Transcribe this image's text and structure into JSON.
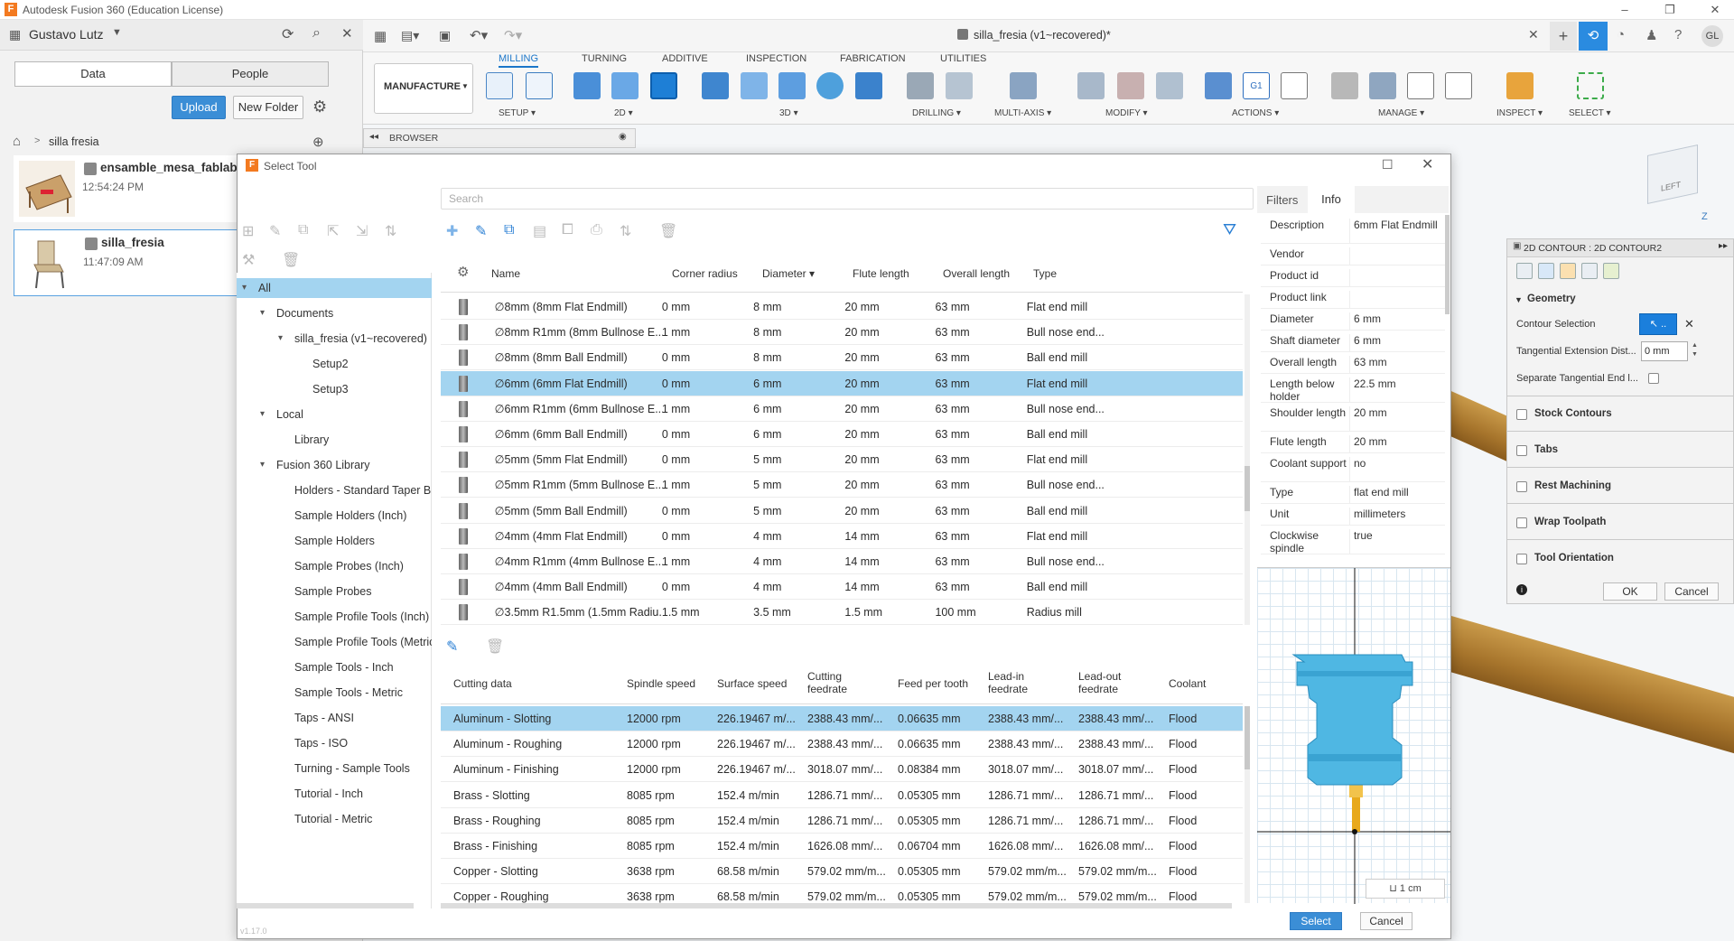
{
  "window": {
    "title": "Autodesk Fusion 360 (Education License)",
    "logo": "F"
  },
  "user": {
    "name": "Gustavo Lutz"
  },
  "left_panel": {
    "tabs": [
      "Data",
      "People"
    ],
    "upload_label": "Upload",
    "new_folder_label": "New Folder",
    "breadcrumb": "silla fresia",
    "items": [
      {
        "name": "ensamble_mesa_fablab",
        "time": "12:54:24 PM"
      },
      {
        "name": "silla_fresia",
        "time": "11:47:09 AM"
      }
    ]
  },
  "document": {
    "tab_title": "silla_fresia (v1~recovered)*"
  },
  "ribbon": {
    "workspace": "MANUFACTURE",
    "tabs": [
      "MILLING",
      "TURNING",
      "ADDITIVE",
      "INSPECTION",
      "FABRICATION",
      "UTILITIES"
    ],
    "groups": [
      "SETUP",
      "2D",
      "3D",
      "DRILLING",
      "MULTI-AXIS",
      "MODIFY",
      "ACTIONS",
      "MANAGE",
      "INSPECT",
      "SELECT"
    ]
  },
  "browser": {
    "label": "BROWSER"
  },
  "dialog": {
    "title": "Select Tool",
    "search_placeholder": "Search",
    "right_tabs": [
      "Filters",
      "Info"
    ],
    "select_label": "Select",
    "cancel_label": "Cancel",
    "version": "v1.17.0"
  },
  "tree": [
    {
      "label": "All",
      "level": 0,
      "selected": true,
      "arrow": "▾"
    },
    {
      "label": "Documents",
      "level": 1,
      "arrow": "▾"
    },
    {
      "label": "silla_fresia (v1~recovered)",
      "level": 2,
      "arrow": "▾"
    },
    {
      "label": "Setup2",
      "level": 3
    },
    {
      "label": "Setup3",
      "level": 3
    },
    {
      "label": "Local",
      "level": 1,
      "arrow": "▾"
    },
    {
      "label": "Library",
      "level": 2
    },
    {
      "label": "Fusion 360 Library",
      "level": 1,
      "arrow": "▾"
    },
    {
      "label": "Holders - Standard Taper Blanks",
      "level": 2
    },
    {
      "label": "Sample Holders (Inch)",
      "level": 2
    },
    {
      "label": "Sample Holders",
      "level": 2
    },
    {
      "label": "Sample Probes (Inch)",
      "level": 2
    },
    {
      "label": "Sample Probes",
      "level": 2
    },
    {
      "label": "Sample Profile Tools (Inch)",
      "level": 2
    },
    {
      "label": "Sample Profile Tools (Metric)",
      "level": 2
    },
    {
      "label": "Sample Tools - Inch",
      "level": 2
    },
    {
      "label": "Sample Tools - Metric",
      "level": 2
    },
    {
      "label": "Taps - ANSI",
      "level": 2
    },
    {
      "label": "Taps - ISO",
      "level": 2
    },
    {
      "label": "Turning - Sample Tools",
      "level": 2
    },
    {
      "label": "Tutorial - Inch",
      "level": 2
    },
    {
      "label": "Tutorial - Metric",
      "level": 2
    }
  ],
  "tools": {
    "columns": [
      "Name",
      "Corner radius",
      "Diameter",
      "Flute length",
      "Overall length",
      "Type"
    ],
    "sort_indicator": "▾",
    "rows": [
      {
        "name": "∅8mm (8mm Flat Endmill)",
        "corner": "0 mm",
        "dia": "8 mm",
        "flute": "20 mm",
        "overall": "63 mm",
        "type": "Flat end mill"
      },
      {
        "name": "∅8mm R1mm (8mm Bullnose E...",
        "corner": "1 mm",
        "dia": "8 mm",
        "flute": "20 mm",
        "overall": "63 mm",
        "type": "Bull nose end..."
      },
      {
        "name": "∅8mm (8mm Ball Endmill)",
        "corner": "0 mm",
        "dia": "8 mm",
        "flute": "20 mm",
        "overall": "63 mm",
        "type": "Ball end mill"
      },
      {
        "name": "∅6mm (6mm Flat Endmill)",
        "corner": "0 mm",
        "dia": "6 mm",
        "flute": "20 mm",
        "overall": "63 mm",
        "type": "Flat end mill",
        "selected": true
      },
      {
        "name": "∅6mm R1mm (6mm Bullnose E...",
        "corner": "1 mm",
        "dia": "6 mm",
        "flute": "20 mm",
        "overall": "63 mm",
        "type": "Bull nose end..."
      },
      {
        "name": "∅6mm (6mm Ball Endmill)",
        "corner": "0 mm",
        "dia": "6 mm",
        "flute": "20 mm",
        "overall": "63 mm",
        "type": "Ball end mill"
      },
      {
        "name": "∅5mm (5mm Flat Endmill)",
        "corner": "0 mm",
        "dia": "5 mm",
        "flute": "20 mm",
        "overall": "63 mm",
        "type": "Flat end mill"
      },
      {
        "name": "∅5mm R1mm (5mm Bullnose E...",
        "corner": "1 mm",
        "dia": "5 mm",
        "flute": "20 mm",
        "overall": "63 mm",
        "type": "Bull nose end..."
      },
      {
        "name": "∅5mm (5mm Ball Endmill)",
        "corner": "0 mm",
        "dia": "5 mm",
        "flute": "20 mm",
        "overall": "63 mm",
        "type": "Ball end mill"
      },
      {
        "name": "∅4mm (4mm Flat Endmill)",
        "corner": "0 mm",
        "dia": "4 mm",
        "flute": "14 mm",
        "overall": "63 mm",
        "type": "Flat end mill"
      },
      {
        "name": "∅4mm R1mm (4mm Bullnose E...",
        "corner": "1 mm",
        "dia": "4 mm",
        "flute": "14 mm",
        "overall": "63 mm",
        "type": "Bull nose end..."
      },
      {
        "name": "∅4mm (4mm Ball Endmill)",
        "corner": "0 mm",
        "dia": "4 mm",
        "flute": "14 mm",
        "overall": "63 mm",
        "type": "Ball end mill"
      },
      {
        "name": "∅3.5mm R1.5mm (1.5mm Radiu...",
        "corner": "1.5 mm",
        "dia": "3.5 mm",
        "flute": "1.5 mm",
        "overall": "100 mm",
        "type": "Radius mill"
      }
    ]
  },
  "cutting": {
    "columns": [
      "Cutting data",
      "Spindle speed",
      "Surface speed",
      "Cutting feedrate",
      "Feed per tooth",
      "Lead-in feedrate",
      "Lead-out feedrate",
      "Coolant"
    ],
    "rows": [
      {
        "name": "Aluminum - Slotting",
        "spindle": "12000 rpm",
        "surface": "226.19467 m/...",
        "feed": "2388.43 mm/...",
        "fpt": "0.06635 mm",
        "leadin": "2388.43 mm/...",
        "leadout": "2388.43 mm/...",
        "coolant": "Flood",
        "selected": true
      },
      {
        "name": "Aluminum - Roughing",
        "spindle": "12000 rpm",
        "surface": "226.19467 m/...",
        "feed": "2388.43 mm/...",
        "fpt": "0.06635 mm",
        "leadin": "2388.43 mm/...",
        "leadout": "2388.43 mm/...",
        "coolant": "Flood"
      },
      {
        "name": "Aluminum - Finishing",
        "spindle": "12000 rpm",
        "surface": "226.19467 m/...",
        "feed": "3018.07 mm/...",
        "fpt": "0.08384 mm",
        "leadin": "3018.07 mm/...",
        "leadout": "3018.07 mm/...",
        "coolant": "Flood"
      },
      {
        "name": "Brass - Slotting",
        "spindle": "8085 rpm",
        "surface": "152.4 m/min",
        "feed": "1286.71 mm/...",
        "fpt": "0.05305 mm",
        "leadin": "1286.71 mm/...",
        "leadout": "1286.71 mm/...",
        "coolant": "Flood"
      },
      {
        "name": "Brass - Roughing",
        "spindle": "8085 rpm",
        "surface": "152.4 m/min",
        "feed": "1286.71 mm/...",
        "fpt": "0.05305 mm",
        "leadin": "1286.71 mm/...",
        "leadout": "1286.71 mm/...",
        "coolant": "Flood"
      },
      {
        "name": "Brass - Finishing",
        "spindle": "8085 rpm",
        "surface": "152.4 m/min",
        "feed": "1626.08 mm/...",
        "fpt": "0.06704 mm",
        "leadin": "1626.08 mm/...",
        "leadout": "1626.08 mm/...",
        "coolant": "Flood"
      },
      {
        "name": "Copper - Slotting",
        "spindle": "3638 rpm",
        "surface": "68.58 m/min",
        "feed": "579.02 mm/m...",
        "fpt": "0.05305 mm",
        "leadin": "579.02 mm/m...",
        "leadout": "579.02 mm/m...",
        "coolant": "Flood"
      },
      {
        "name": "Copper - Roughing",
        "spindle": "3638 rpm",
        "surface": "68.58 m/min",
        "feed": "579.02 mm/m...",
        "fpt": "0.05305 mm",
        "leadin": "579.02 mm/m...",
        "leadout": "579.02 mm/m...",
        "coolant": "Flood"
      }
    ]
  },
  "info": [
    {
      "label": "Description",
      "value": "6mm Flat Endmill"
    },
    {
      "label": "Vendor",
      "value": ""
    },
    {
      "label": "Product id",
      "value": ""
    },
    {
      "label": "Product link",
      "value": ""
    },
    {
      "label": "Diameter",
      "value": "6 mm"
    },
    {
      "label": "Shaft diameter",
      "value": "6 mm"
    },
    {
      "label": "Overall length",
      "value": "63 mm"
    },
    {
      "label": "Length below holder",
      "value": "22.5 mm"
    },
    {
      "label": "Shoulder length",
      "value": "20 mm"
    },
    {
      "label": "Flute length",
      "value": "20 mm"
    },
    {
      "label": "Coolant support",
      "value": "no"
    },
    {
      "label": "Type",
      "value": "flat end mill"
    },
    {
      "label": "Unit",
      "value": "millimeters"
    },
    {
      "label": "Clockwise spindle",
      "value": "true"
    }
  ],
  "preview": {
    "scale_label": "1 cm",
    "holder_color": "#4fb7e3",
    "tool_color": "#e8a91c"
  },
  "contour": {
    "title": "2D CONTOUR : 2D CONTOUR2",
    "geometry_label": "Geometry",
    "contour_selection_label": "Contour Selection",
    "tangential_ext_label": "Tangential Extension Dist...",
    "tangential_ext_value": "0 mm",
    "separate_tangential_label": "Separate Tangential End l...",
    "sections": [
      "Stock Contours",
      "Tabs",
      "Rest Machining",
      "Wrap Toolpath",
      "Tool Orientation"
    ],
    "ok_label": "OK",
    "cancel_label": "Cancel"
  },
  "viewcube": {
    "face_label": "LEFT",
    "axis_label": "Z"
  },
  "colors": {
    "accent": "#1b76c9",
    "selection": "#a3d4f0",
    "wood": "#b98a3e"
  }
}
